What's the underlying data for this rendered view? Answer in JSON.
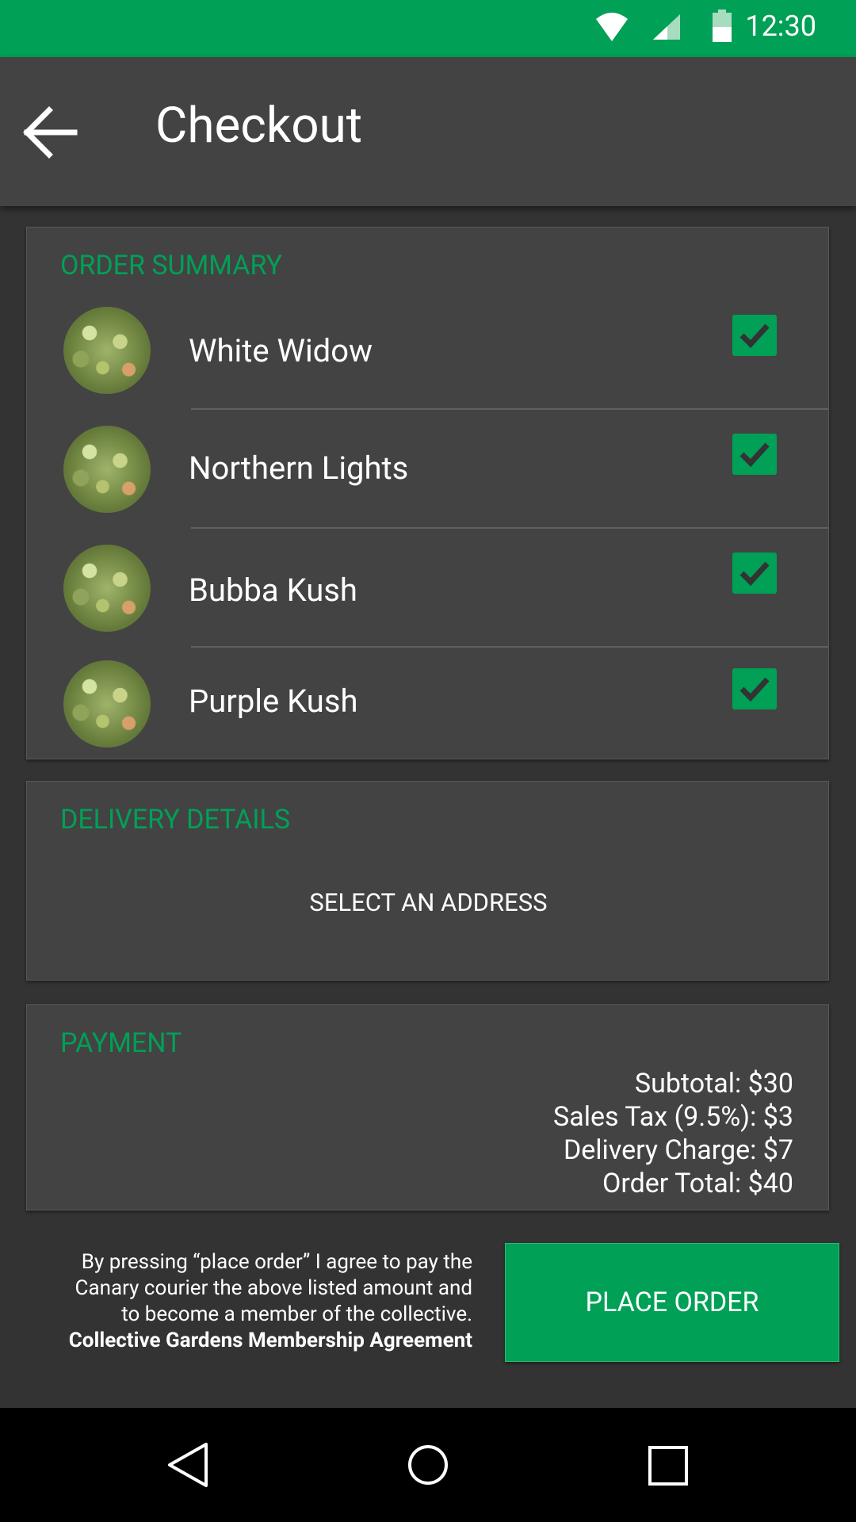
{
  "status_bar": {
    "time": "12:30",
    "icons": [
      "wifi-icon",
      "cell-signal-icon",
      "battery-icon"
    ]
  },
  "app_bar": {
    "title": "Checkout",
    "back_icon": "arrow-back-icon"
  },
  "order_summary": {
    "title": "ORDER SUMMARY",
    "items": [
      {
        "name": "White Widow",
        "checked": true
      },
      {
        "name": "Northern Lights",
        "checked": true
      },
      {
        "name": "Bubba Kush",
        "checked": true
      },
      {
        "name": "Purple Kush",
        "checked": true
      }
    ]
  },
  "delivery": {
    "title": "DELIVERY DETAILS",
    "select_label": "SELECT AN ADDRESS"
  },
  "payment": {
    "title": "PAYMENT",
    "subtotal": "Subtotal: $30",
    "tax": "Sales Tax (9.5%): $3",
    "delivery_charge": "Delivery Charge: $7",
    "total": "Order Total: $40"
  },
  "footer": {
    "disclaimer_line1": "By pressing “place order” I agree to pay the",
    "disclaimer_line2": "Canary courier the above listed amount and",
    "disclaimer_line3": "to become a member of the collective.",
    "agreement_link": "Collective Gardens Membership Agreement",
    "place_order_label": "PLACE ORDER"
  },
  "nav_bar": {
    "icons": [
      "nav-back-icon",
      "nav-home-icon",
      "nav-recents-icon"
    ]
  },
  "colors": {
    "accent": "#00a056",
    "card": "#434343",
    "background": "#333333"
  }
}
